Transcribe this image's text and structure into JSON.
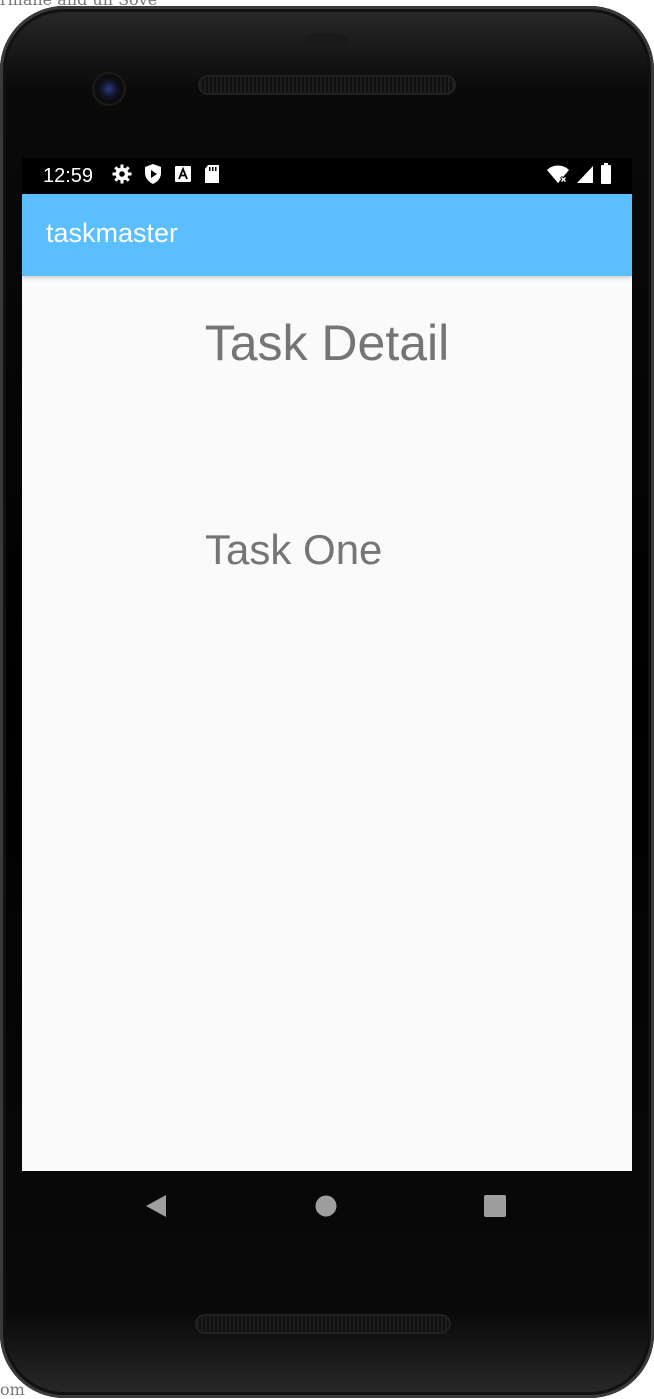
{
  "status_bar": {
    "time": "12:59",
    "left_icons": [
      "gear-icon",
      "shield-play-icon",
      "font-a-icon",
      "sd-card-icon"
    ],
    "right_icons": [
      "wifi-icon",
      "cell-signal-icon",
      "battery-icon"
    ]
  },
  "app_bar": {
    "title": "taskmaster",
    "color": "#5abeff"
  },
  "content": {
    "heading": "Task Detail",
    "task_name": "Task One",
    "text_color": "#757575"
  },
  "nav_bar": {
    "buttons": [
      "back-icon",
      "home-icon",
      "recents-icon"
    ]
  }
}
